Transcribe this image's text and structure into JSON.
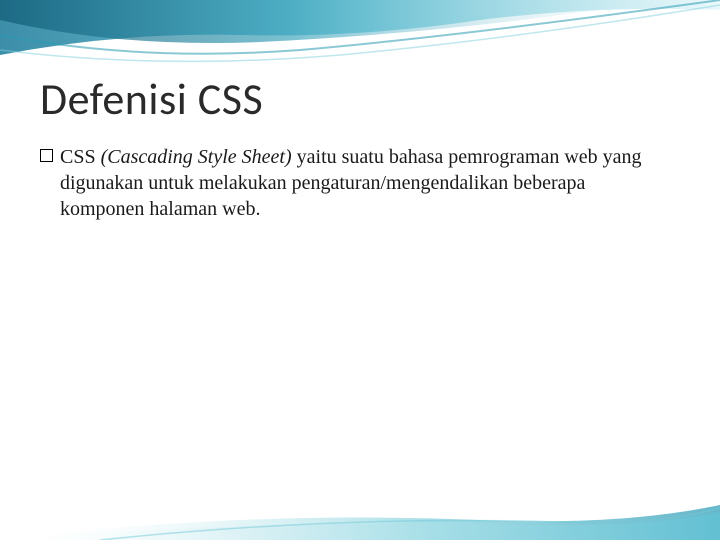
{
  "slide": {
    "title": "Defenisi CSS",
    "bullet_lead": "CSS ",
    "bullet_italic": "(Cascading Style Sheet) ",
    "bullet_rest": "yaitu suatu bahasa pemrograman web yang digunakan untuk melakukan pengaturan/mengendalikan beberapa komponen halaman web."
  },
  "theme": {
    "wave_color_1": "#4fb3c9",
    "wave_color_2": "#1a7a99",
    "wave_color_3": "#9fd8e3"
  }
}
